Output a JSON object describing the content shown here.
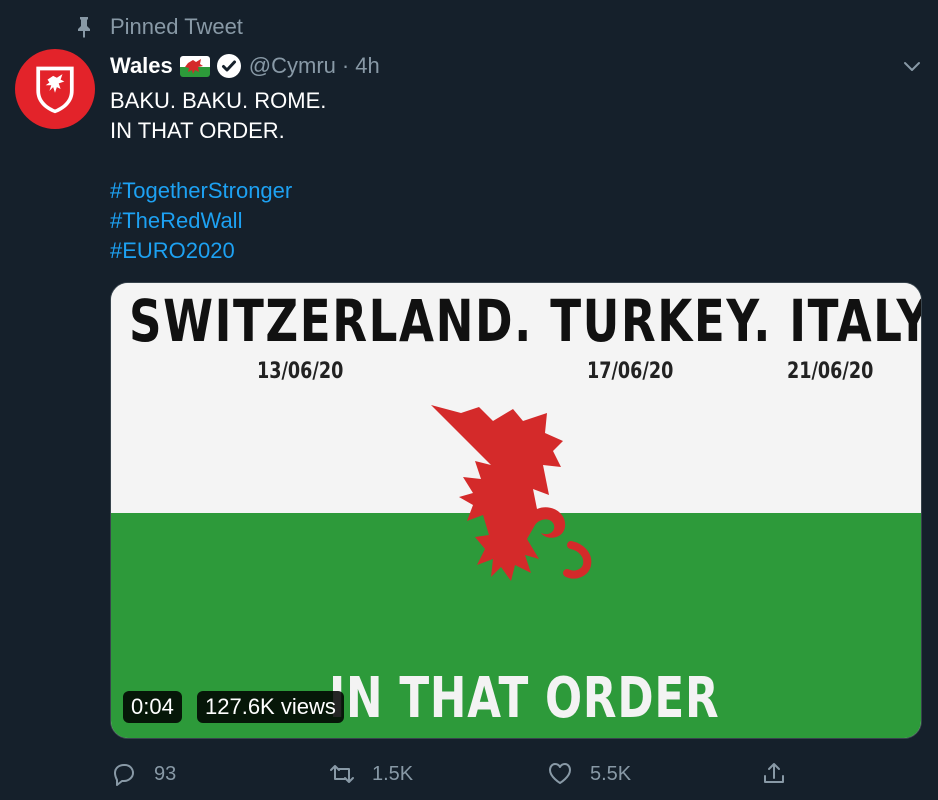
{
  "pinned": {
    "label": "Pinned Tweet",
    "icon": "pin-icon"
  },
  "author": {
    "name": "Wales",
    "handle": "@Cymru",
    "separator": "·",
    "time": "4h",
    "verified": true,
    "avatar_icon": "wales-crest-icon"
  },
  "tweet": {
    "lines": [
      "BAKU. BAKU. ROME.",
      "IN THAT ORDER."
    ],
    "hashtags": [
      "#TogetherStronger",
      "#TheRedWall",
      "#EURO2020"
    ]
  },
  "media": {
    "title": "SWITZERLAND. TURKEY. ITALY.",
    "dates": [
      "13/06/20",
      "17/06/20",
      "21/06/20"
    ],
    "caption": "IN THAT ORDER",
    "video_time": "0:04",
    "views": "127.6K views"
  },
  "actions": {
    "replies": "93",
    "retweets": "1.5K",
    "likes": "5.5K"
  },
  "colors": {
    "background": "#15202b",
    "secondary_text": "#8899a6",
    "link": "#1da1f2",
    "flag_red": "#d42a2a",
    "flag_green": "#2d9a3a"
  }
}
